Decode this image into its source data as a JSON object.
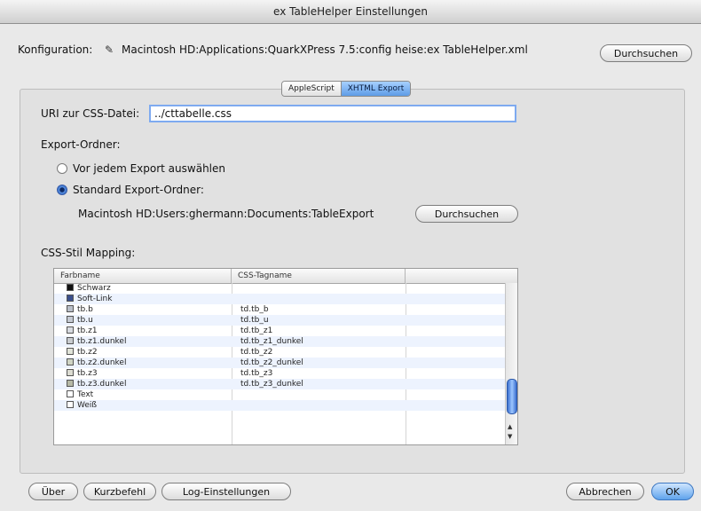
{
  "window": {
    "title": "ex TableHelper Einstellungen"
  },
  "config": {
    "label": "Konfiguration:",
    "path": "Macintosh HD:Applications:QuarkXPress 7.5:config heise:ex TableHelper.xml",
    "browse_label": "Durchsuchen"
  },
  "tabs": [
    {
      "label": "AppleScript",
      "active": false
    },
    {
      "label": "XHTML Export",
      "active": true
    }
  ],
  "css": {
    "label": "URI zur CSS-Datei:",
    "value": "../cttabelle.css"
  },
  "export": {
    "label": "Export-Ordner:",
    "option_choose": "Vor jedem Export auswählen",
    "option_standard": "Standard Export-Ordner:",
    "selected": "standard",
    "standard_path": "Macintosh HD:Users:ghermann:Documents:TableExport",
    "browse_label": "Durchsuchen"
  },
  "mapping": {
    "label": "CSS-Stil Mapping:",
    "columns": [
      "Farbname",
      "CSS-Tagname"
    ],
    "rows": [
      {
        "name": "Schwarz",
        "tag": "",
        "color": "#111111"
      },
      {
        "name": "Soft-Link",
        "tag": "",
        "color": "#3b4f8c"
      },
      {
        "name": "tb.b",
        "tag": "td.tb_b",
        "color": "#b9bfc9"
      },
      {
        "name": "tb.u",
        "tag": "td.tb_u",
        "color": "#c5cad3"
      },
      {
        "name": "tb.z1",
        "tag": "td.tb_z1",
        "color": "#d8dbe1"
      },
      {
        "name": "tb.z1.dunkel",
        "tag": "td.tb_z1_dunkel",
        "color": "#c9ccd0"
      },
      {
        "name": "tb.z2",
        "tag": "td.tb_z2",
        "color": "#e1e4d9"
      },
      {
        "name": "tb.z2.dunkel",
        "tag": "td.tb_z2_dunkel",
        "color": "#cfd4c4"
      },
      {
        "name": "tb.z3",
        "tag": "td.tb_z3",
        "color": "#dcdcd2"
      },
      {
        "name": "tb.z3.dunkel",
        "tag": "td.tb_z3_dunkel",
        "color": "#b6b9a6"
      },
      {
        "name": "Text",
        "tag": "",
        "color": "#ffffff"
      },
      {
        "name": "Weiß",
        "tag": "",
        "color": "#ffffff"
      }
    ]
  },
  "footer": {
    "about": "Über",
    "shortcut": "Kurzbefehl",
    "log": "Log-Einstellungen",
    "cancel": "Abbrechen",
    "ok": "OK"
  }
}
